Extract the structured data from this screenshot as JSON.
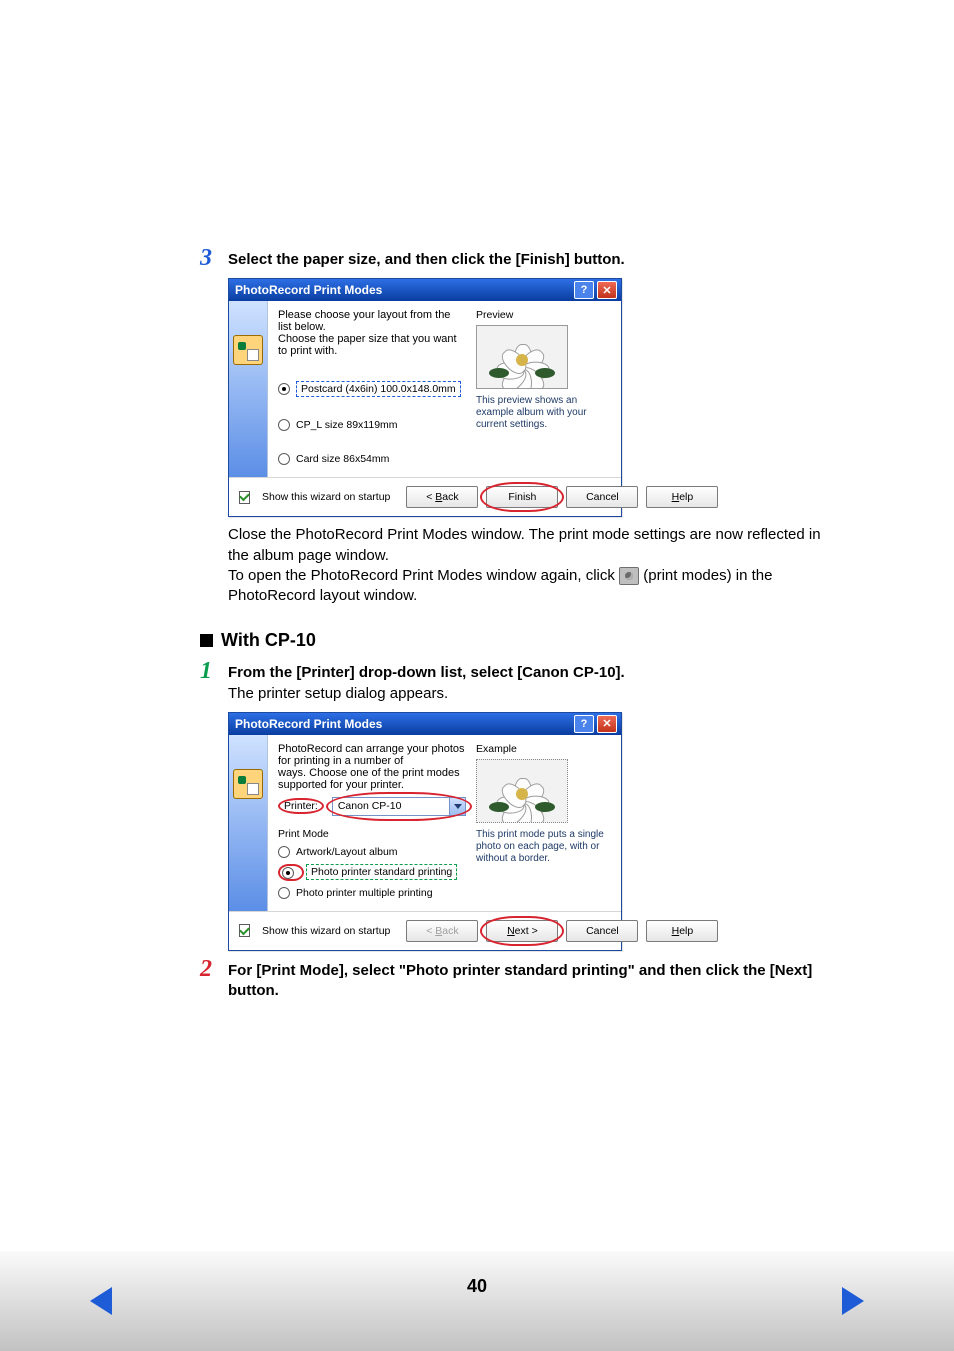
{
  "step3": {
    "number": "3",
    "text": "Select the paper size, and then click the [Finish] button."
  },
  "dialog1": {
    "title": "PhotoRecord Print Modes",
    "intro1": "Please choose your layout from the list below.",
    "intro2": "Choose the paper size that you want to print with.",
    "preview_label": "Preview",
    "options": {
      "postcard": "Postcard (4x6in) 100.0x148.0mm",
      "cpl": "CP_L size 89x119mm",
      "card": "Card size 86x54mm"
    },
    "note": "This preview shows an example album with your current settings.",
    "show_wizard": "Show this wizard on startup",
    "buttons": {
      "back": "< Back",
      "finish": "Finish",
      "cancel": "Cancel",
      "help": "Help"
    }
  },
  "note_after": {
    "line1": "Close the PhotoRecord Print Modes window. The print mode settings are now reflected in the album page window.",
    "line2a": "To open the PhotoRecord Print Modes window again, click ",
    "line2b": " (print modes) in the PhotoRecord layout window."
  },
  "section_cp10": "With CP-10",
  "step1": {
    "number": "1",
    "text": "From the [Printer] drop-down list, select [Canon CP-10].",
    "sub": "The printer setup dialog appears."
  },
  "dialog2": {
    "title": "PhotoRecord Print Modes",
    "intro1": "PhotoRecord can arrange your photos for printing in a number of",
    "intro2": "ways. Choose one of the print modes supported for your printer.",
    "printer_label": "Printer:",
    "printer_value": "Canon CP-10",
    "example_label": "Example",
    "pm_label": "Print Mode",
    "pm_artwork": "Artwork/Layout album",
    "pm_standard": "Photo printer standard printing",
    "pm_multiple": "Photo printer multiple printing",
    "note": "This print mode puts a single photo on each page, with or without a border.",
    "show_wizard": "Show this wizard on startup",
    "buttons": {
      "back": "< Back",
      "next": "Next >",
      "cancel": "Cancel",
      "help": "Help"
    }
  },
  "step2": {
    "number": "2",
    "text": "For [Print Mode], select \"Photo printer standard printing\" and then click the [Next] button."
  },
  "page_number": "40"
}
